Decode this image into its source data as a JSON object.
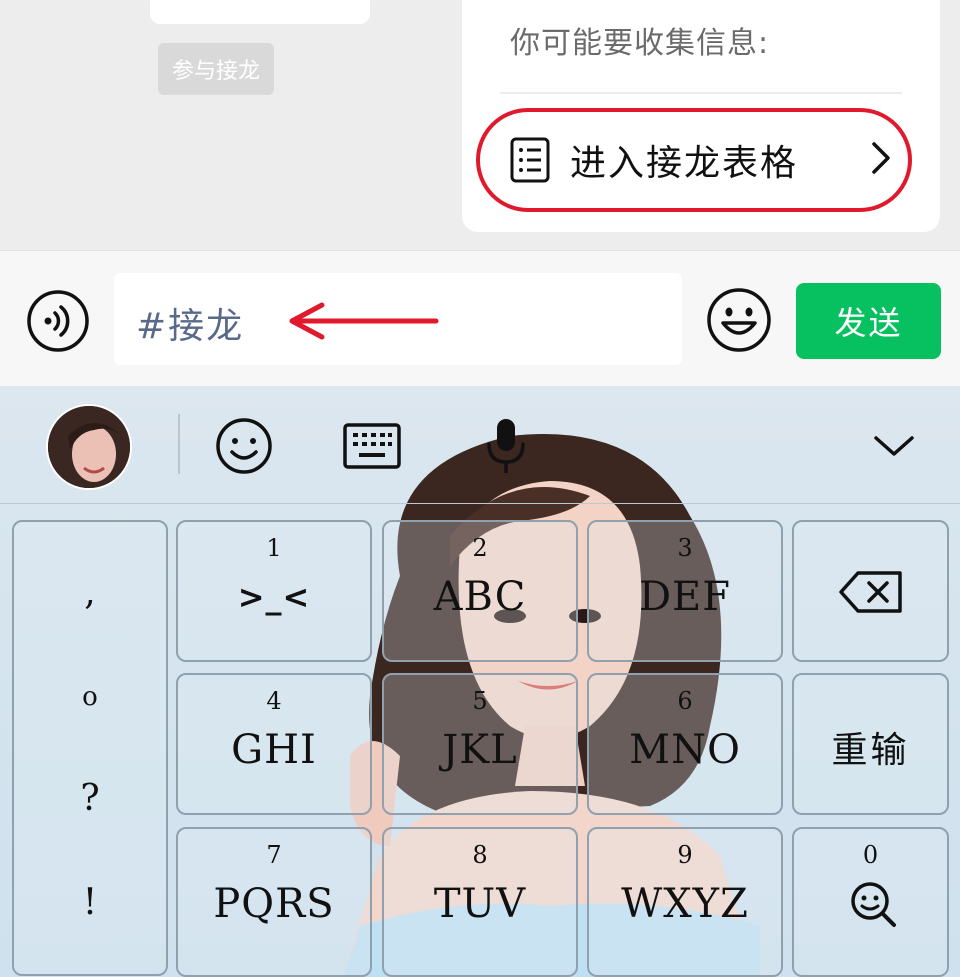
{
  "chat": {
    "join_chip": "参与接龙",
    "card": {
      "hint": "你可能要收集信息:",
      "link_label": "进入接龙表格"
    }
  },
  "input_bar": {
    "text_value": "#接龙",
    "send_label": "发送"
  },
  "keyboard": {
    "toolbar_icons": [
      "avatar",
      "smile-icon",
      "keyboard-icon",
      "microphone-icon",
      "chevron-down-icon"
    ],
    "punctuation": [
      ",",
      "o",
      "?",
      "!"
    ],
    "keys": [
      {
        "num": "1",
        "letters": ">_<"
      },
      {
        "num": "2",
        "letters": "ABC"
      },
      {
        "num": "3",
        "letters": "DEF"
      },
      {
        "num": "4",
        "letters": "GHI"
      },
      {
        "num": "5",
        "letters": "JKL"
      },
      {
        "num": "6",
        "letters": "MNO"
      },
      {
        "num": "7",
        "letters": "PQRS"
      },
      {
        "num": "8",
        "letters": "TUV"
      },
      {
        "num": "9",
        "letters": "WXYZ"
      }
    ],
    "clear_label": "重输",
    "search_num": "0"
  },
  "colors": {
    "send_green": "#07c160",
    "highlight_red": "#e0192d",
    "input_text": "#59698a"
  }
}
